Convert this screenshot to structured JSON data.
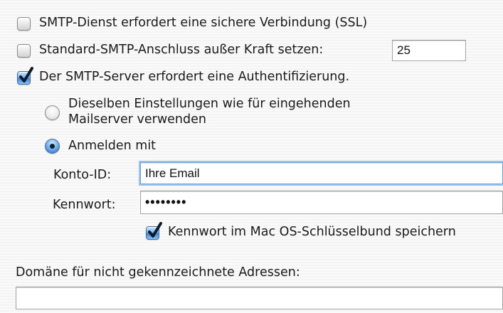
{
  "smtp": {
    "ssl": {
      "label": "SMTP-Dienst erfordert eine sichere Verbindung (SSL)",
      "checked": false
    },
    "port_override": {
      "label": "Standard-SMTP-Anschluss außer Kraft setzen:",
      "checked": false,
      "port": "25"
    },
    "auth": {
      "label": "Der SMTP-Server erfordert eine Authentifizierung.",
      "checked": true
    },
    "auth_mode": {
      "same_settings": {
        "line1": "Dieselben Einstellungen wie für eingehenden",
        "line2": "Mailserver verwenden",
        "selected": false
      },
      "login_with": {
        "label": "Anmelden mit",
        "selected": true
      }
    },
    "account_id": {
      "label": "Konto-ID:",
      "value": "Ihre Email"
    },
    "password": {
      "label": "Kennwort:",
      "value": "••••••••"
    },
    "keychain": {
      "label": "Kennwort im Mac OS-Schlüsselbund speichern",
      "checked": true
    },
    "unqualified_domain": {
      "label": "Domäne für nicht gekennzeichnete Adressen:",
      "value": ""
    }
  },
  "colors": {
    "accent": "#3f86d6",
    "focus_ring": "#9cc3ee"
  }
}
